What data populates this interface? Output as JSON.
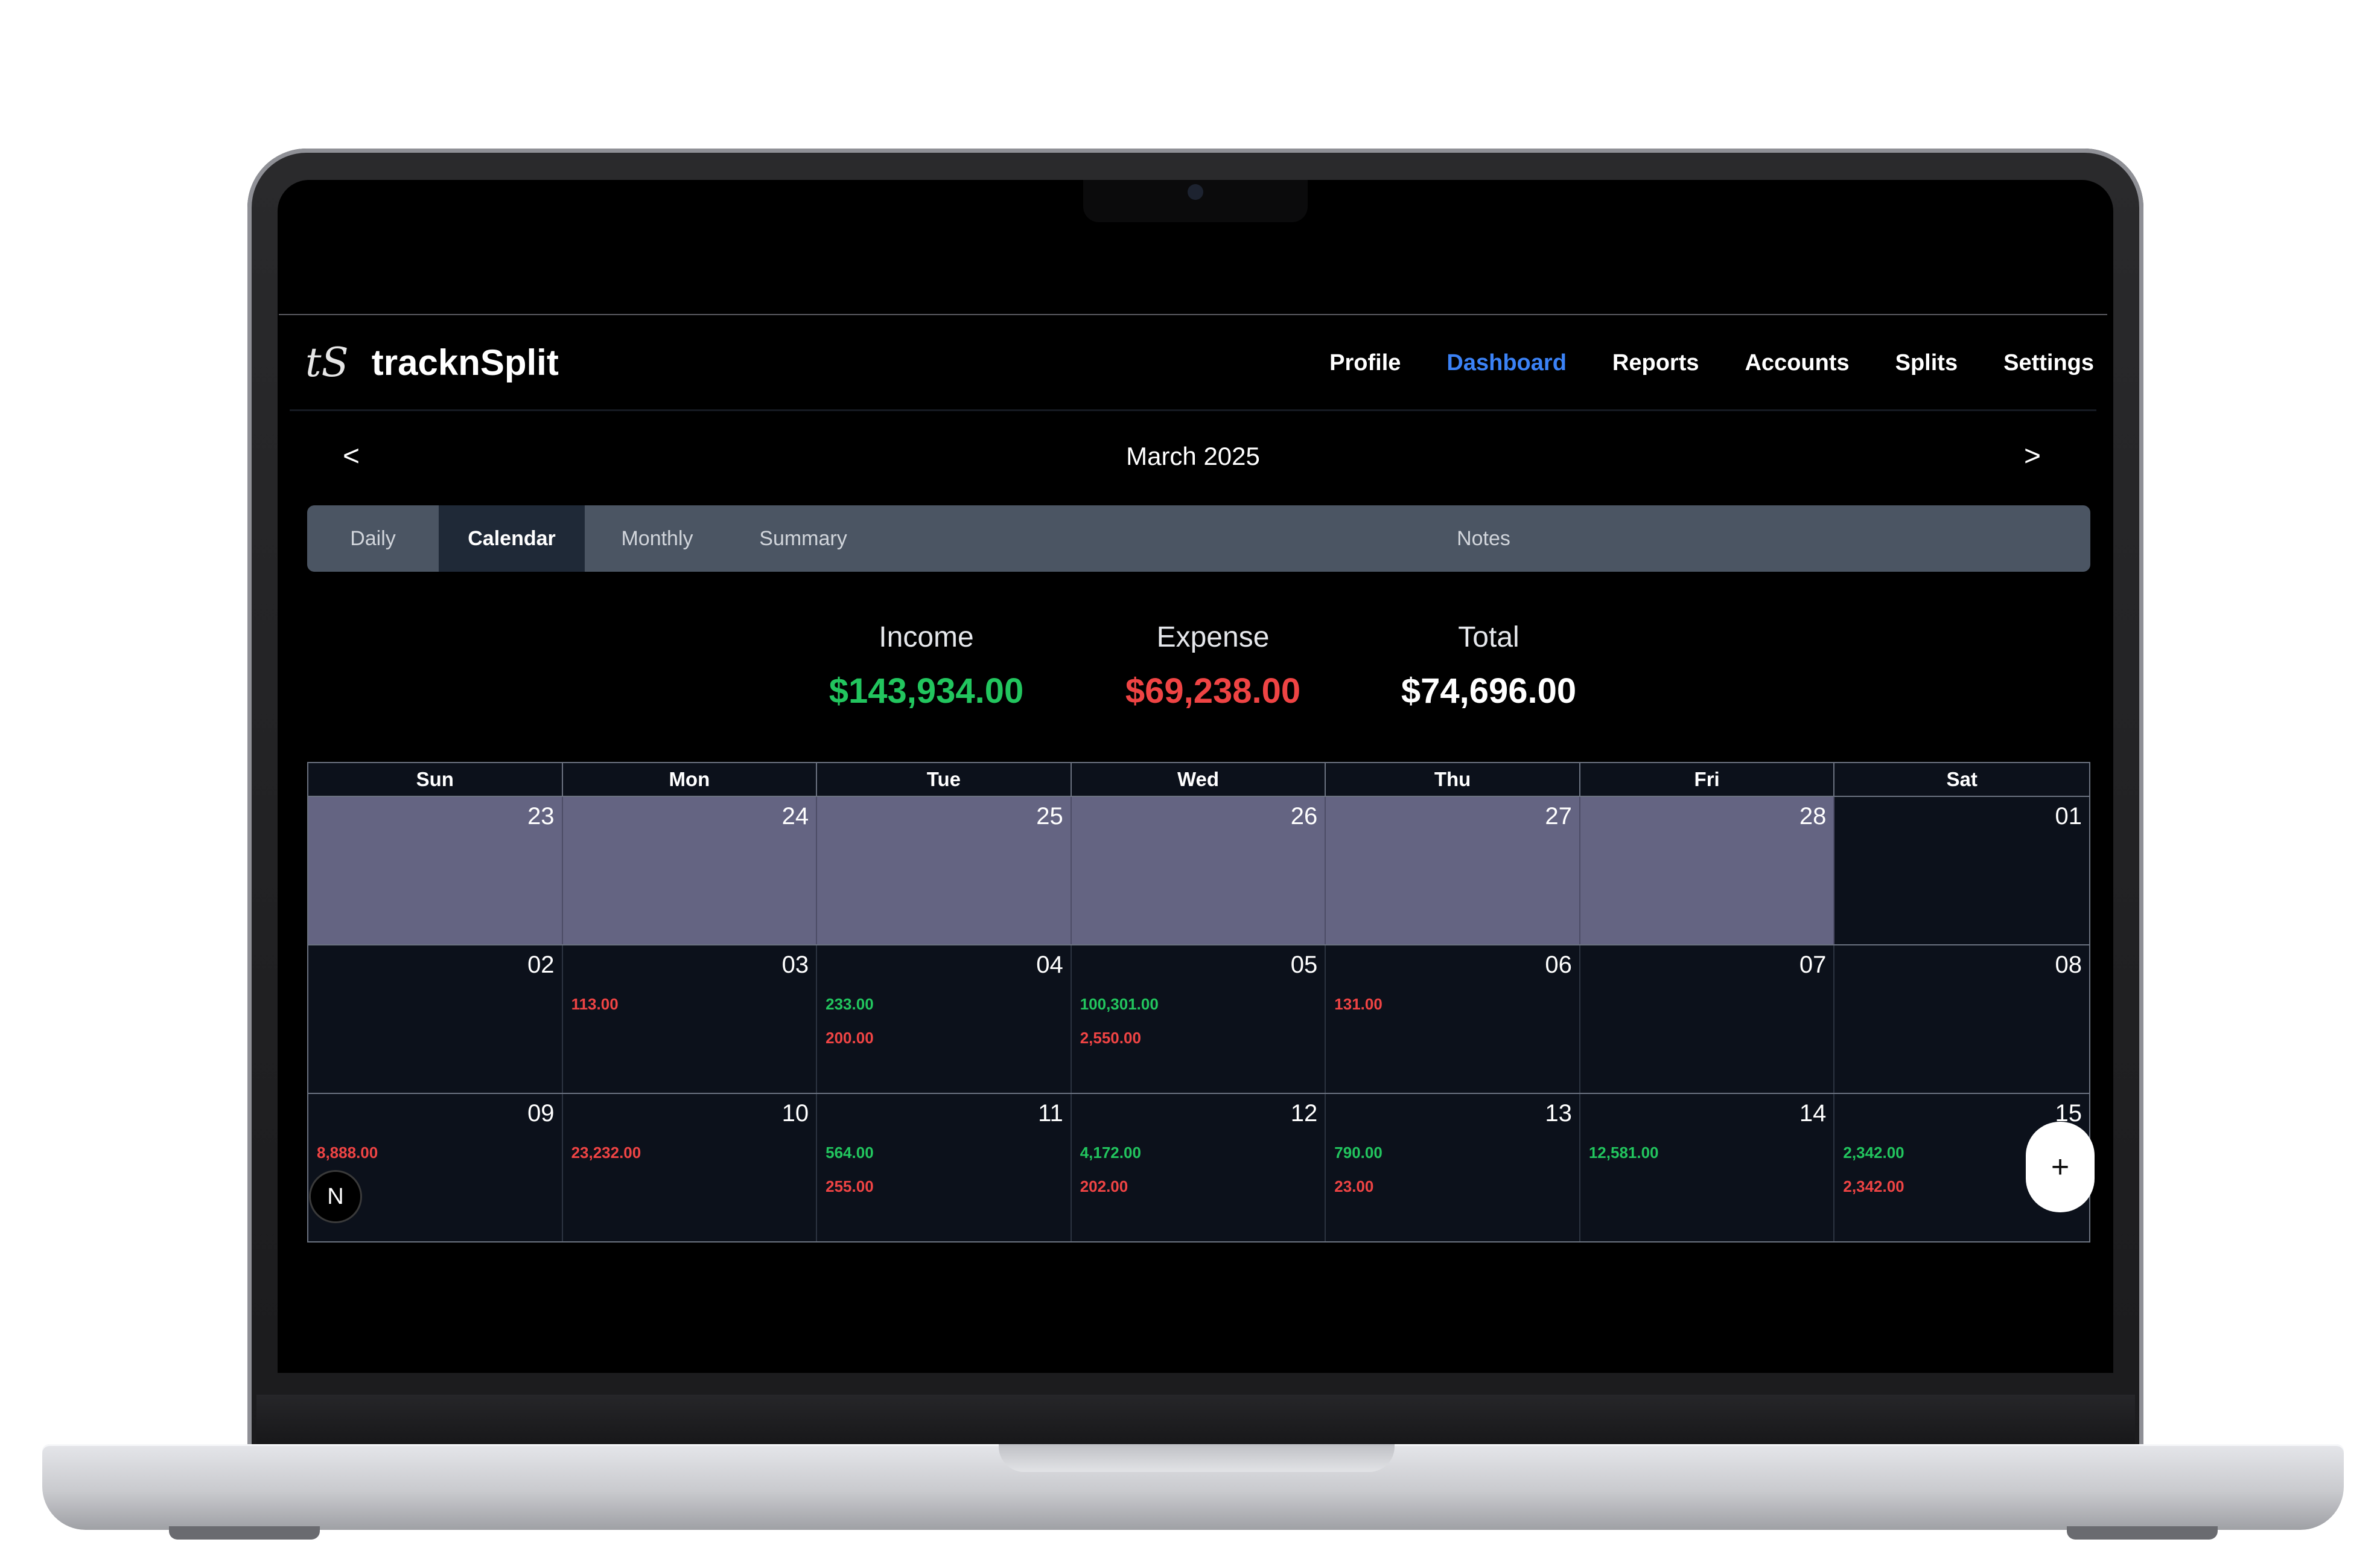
{
  "app": {
    "logo": "tS",
    "name": "tracknSplit"
  },
  "nav": {
    "items": [
      {
        "label": "Profile",
        "active": false
      },
      {
        "label": "Dashboard",
        "active": true
      },
      {
        "label": "Reports",
        "active": false
      },
      {
        "label": "Accounts",
        "active": false
      },
      {
        "label": "Splits",
        "active": false
      },
      {
        "label": "Settings",
        "active": false
      }
    ]
  },
  "month": {
    "label": "March 2025",
    "prev": "<",
    "next": ">"
  },
  "tabs": [
    {
      "label": "Daily",
      "active": false
    },
    {
      "label": "Calendar",
      "active": true
    },
    {
      "label": "Monthly",
      "active": false
    },
    {
      "label": "Summary",
      "active": false
    },
    {
      "label": "Notes",
      "active": false
    }
  ],
  "summary": {
    "income": {
      "label": "Income",
      "value": "$143,934.00",
      "color": "#22c55e"
    },
    "expense": {
      "label": "Expense",
      "value": "$69,238.00",
      "color": "#ef4444"
    },
    "total": {
      "label": "Total",
      "value": "$74,696.00",
      "color": "#ffffff"
    }
  },
  "calendar": {
    "weekdays": [
      "Sun",
      "Mon",
      "Tue",
      "Wed",
      "Thu",
      "Fri",
      "Sat"
    ],
    "weeks": [
      [
        {
          "day": "23",
          "other": true
        },
        {
          "day": "24",
          "other": true
        },
        {
          "day": "25",
          "other": true
        },
        {
          "day": "26",
          "other": true
        },
        {
          "day": "27",
          "other": true
        },
        {
          "day": "28",
          "other": true
        },
        {
          "day": "01"
        }
      ],
      [
        {
          "day": "02"
        },
        {
          "day": "03",
          "expense": "113.00"
        },
        {
          "day": "04",
          "income": "233.00",
          "expense": "200.00"
        },
        {
          "day": "05",
          "income": "100,301.00",
          "expense": "2,550.00"
        },
        {
          "day": "06",
          "expense": "131.00"
        },
        {
          "day": "07"
        },
        {
          "day": "08"
        }
      ],
      [
        {
          "day": "09",
          "expense": "8,888.00"
        },
        {
          "day": "10",
          "expense": "23,232.00"
        },
        {
          "day": "11",
          "income": "564.00",
          "expense": "255.00"
        },
        {
          "day": "12",
          "income": "4,172.00",
          "expense": "202.00"
        },
        {
          "day": "13",
          "income": "790.00",
          "expense": "23.00"
        },
        {
          "day": "14",
          "income": "12,581.00"
        },
        {
          "day": "15",
          "income": "2,342.00",
          "expense": "2,342.00"
        }
      ]
    ]
  },
  "fab": {
    "label": "+"
  },
  "dev_badge": {
    "label": "N"
  }
}
